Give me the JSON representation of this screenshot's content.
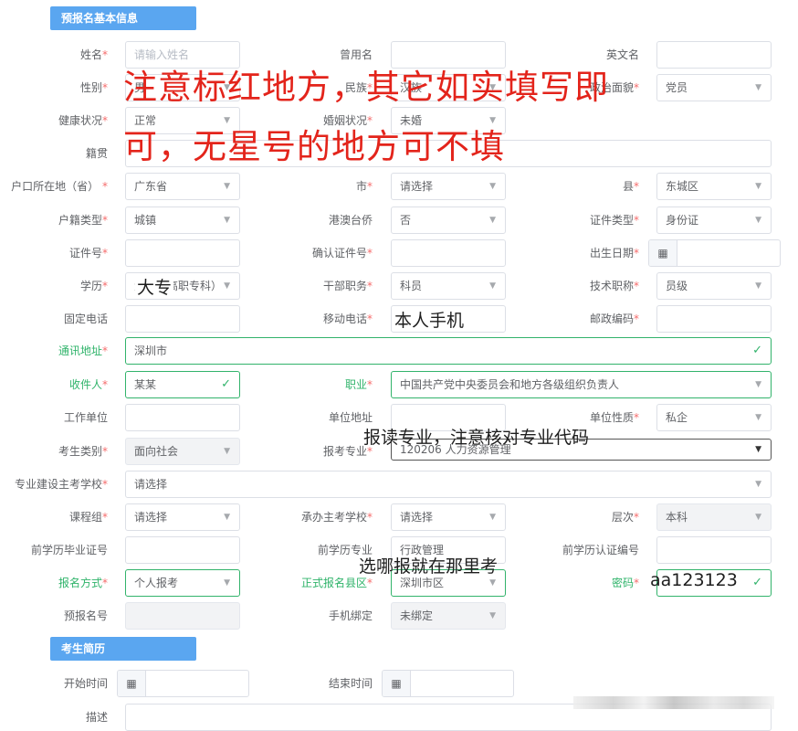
{
  "sections": {
    "basic": "预报名基本信息",
    "resume": "考生简历"
  },
  "form": {
    "name": {
      "label": "姓名",
      "placeholder": "请输入姓名"
    },
    "former_name": {
      "label": "曾用名"
    },
    "english_name": {
      "label": "英文名"
    },
    "gender": {
      "label": "性别",
      "value": "男"
    },
    "ethnicity": {
      "label": "民族",
      "value": "汉族"
    },
    "political": {
      "label": "政治面貌",
      "value": "党员"
    },
    "health": {
      "label": "健康状况",
      "value": "正常"
    },
    "marital": {
      "label": "婚姻状况",
      "value": "未婚"
    },
    "native_place": {
      "label": "籍贯"
    },
    "hukou_province": {
      "label": "户口所在地（省）",
      "value": "广东省"
    },
    "city": {
      "label": "市",
      "value": "请选择"
    },
    "county": {
      "label": "县",
      "value": "东城区"
    },
    "hukou_type": {
      "label": "户籍类型",
      "value": "城镇"
    },
    "hk_mo_tw": {
      "label": "港澳台侨",
      "value": "否"
    },
    "id_type": {
      "label": "证件类型",
      "value": "身份证"
    },
    "id_no": {
      "label": "证件号"
    },
    "id_confirm": {
      "label": "确认证件号"
    },
    "birth_date": {
      "label": "出生日期"
    },
    "education": {
      "label": "学历",
      "value": "大专（高职专科）"
    },
    "cadre_post": {
      "label": "干部职务",
      "value": "科员"
    },
    "tech_title": {
      "label": "技术职称",
      "value": "员级"
    },
    "landline": {
      "label": "固定电话"
    },
    "mobile": {
      "label": "移动电话"
    },
    "postcode": {
      "label": "邮政编码"
    },
    "address": {
      "label": "通讯地址",
      "value": "深圳市"
    },
    "recipient": {
      "label": "收件人",
      "value": "某某"
    },
    "occupation": {
      "label": "职业",
      "value": "中国共产党中央委员会和地方各级组织负责人"
    },
    "employer": {
      "label": "工作单位"
    },
    "employer_addr": {
      "label": "单位地址"
    },
    "employer_type": {
      "label": "单位性质",
      "value": "私企"
    },
    "candidate_type": {
      "label": "考生类别",
      "value": "面向社会"
    },
    "major": {
      "label": "报考专业",
      "value": "120206 人力资源管理"
    },
    "major_school": {
      "label": "专业建设主考学校",
      "value": "请选择"
    },
    "course_group": {
      "label": "课程组",
      "value": "请选择"
    },
    "host_school": {
      "label": "承办主考学校",
      "value": "请选择"
    },
    "level": {
      "label": "层次",
      "value": "本科"
    },
    "prev_cert_no": {
      "label": "前学历毕业证号"
    },
    "prev_major": {
      "label": "前学历专业",
      "value": "行政管理"
    },
    "prev_verify_no": {
      "label": "前学历认证编号"
    },
    "reg_method": {
      "label": "报名方式",
      "value": "个人报考"
    },
    "reg_county": {
      "label": "正式报名县区",
      "value": "深圳市区"
    },
    "password": {
      "label": "密码",
      "value": "aa123123"
    },
    "prereg_no": {
      "label": "预报名号"
    },
    "phone_bind": {
      "label": "手机绑定",
      "value": "未绑定"
    },
    "start_time": {
      "label": "开始时间"
    },
    "end_time": {
      "label": "结束时间"
    },
    "description": {
      "label": "描述"
    }
  },
  "annotations": {
    "main_line1": "注意标红地方，其它如实填写即",
    "main_line2": "可，无星号的地方可不填",
    "education_note": "大专",
    "mobile_note": "本人手机",
    "major_note": "报读专业，注意核对专业代码",
    "exam_note": "选哪报就在那里考",
    "password_note": "aa123123"
  },
  "icons": {
    "arrow": "▼",
    "check": "✓",
    "calendar": "▦"
  }
}
